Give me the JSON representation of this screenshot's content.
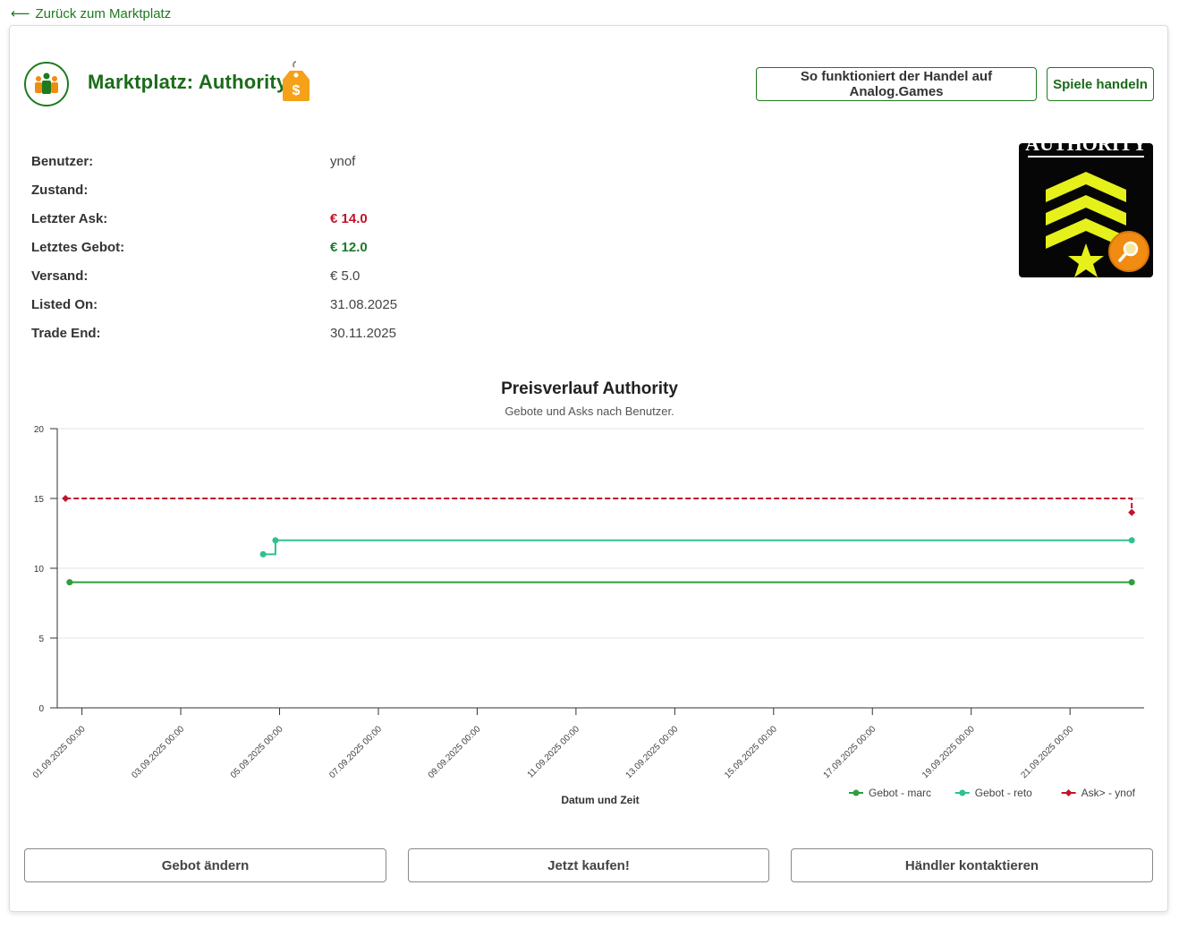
{
  "nav": {
    "back_label": "Zurück zum Marktplatz"
  },
  "header": {
    "title": "Marktplatz: Authority",
    "how_button": "So funktioniert der Handel auf Analog.Games",
    "trade_button": "Spiele handeln",
    "price_tag_symbol": "$"
  },
  "info": [
    {
      "label": "Benutzer:",
      "value": "ynof",
      "style": "plain"
    },
    {
      "label": "Zustand:",
      "value": "",
      "style": "plain"
    },
    {
      "label": "Letzter Ask:",
      "value": "€ 14.0",
      "style": "ask"
    },
    {
      "label": "Letztes Gebot:",
      "value": "€ 12.0",
      "style": "bid"
    },
    {
      "label": "Versand:",
      "value": "€ 5.0",
      "style": "plain"
    },
    {
      "label": "Listed On:",
      "value": "31.08.2025",
      "style": "plain"
    },
    {
      "label": "Trade End:",
      "value": "30.11.2025",
      "style": "plain"
    }
  ],
  "thumbnail": {
    "text": "AUTHORITY",
    "zoom_icon": "magnifier-icon"
  },
  "chart_data": {
    "type": "line",
    "title": "Preisverlauf Authority",
    "subtitle": "Gebote und Asks nach Benutzer.",
    "xlabel": "Datum und Zeit",
    "ylabel": "",
    "ylim": [
      0,
      20
    ],
    "yticks": [
      0,
      5,
      10,
      15,
      20
    ],
    "xlim": [
      "2025-08-31T12:00",
      "2025-09-22T12:00"
    ],
    "xticks": [
      "01.09.2025 00:00",
      "03.09.2025 00:00",
      "05.09.2025 00:00",
      "07.09.2025 00:00",
      "09.09.2025 00:00",
      "11.09.2025 00:00",
      "13.09.2025 00:00",
      "15.09.2025 00:00",
      "17.09.2025 00:00",
      "19.09.2025 00:00",
      "21.09.2025 00:00"
    ],
    "grid": true,
    "legend": "bottom-right",
    "series": [
      {
        "name": "Gebot - marc",
        "color": "#2e9e3e",
        "dash": false,
        "marker": "circle",
        "points": [
          {
            "x": "2025-08-31T18:00",
            "y": 9
          },
          {
            "x": "2025-09-22T06:00",
            "y": 9
          }
        ]
      },
      {
        "name": "Gebot - reto",
        "color": "#2ec28c",
        "dash": false,
        "marker": "circle",
        "points": [
          {
            "x": "2025-09-04T16:00",
            "y": 11
          },
          {
            "x": "2025-09-04T22:00",
            "y": 12
          },
          {
            "x": "2025-09-22T06:00",
            "y": 12
          }
        ]
      },
      {
        "name": "Ask> - ynof",
        "color": "#c0142a",
        "dash": true,
        "marker": "diamond",
        "points": [
          {
            "x": "2025-08-31T16:00",
            "y": 15
          },
          {
            "x": "2025-09-22T06:00",
            "y": 14
          }
        ]
      }
    ]
  },
  "actions": {
    "change_bid": "Gebot ändern",
    "buy_now": "Jetzt kaufen!",
    "contact_dealer": "Händler kontaktieren"
  }
}
